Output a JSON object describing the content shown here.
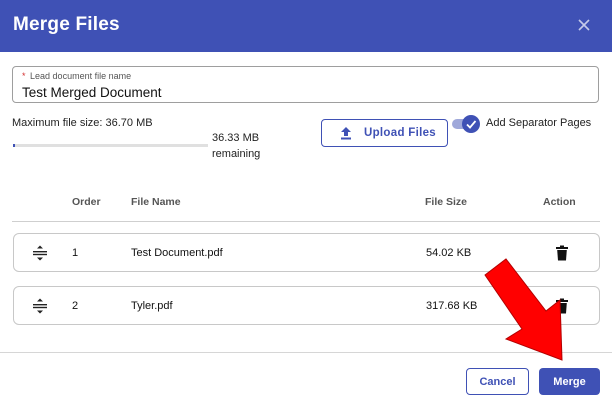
{
  "dialog": {
    "title": "Merge Files"
  },
  "lead_field": {
    "label": "Lead document file name",
    "required_marker": "*",
    "value": "Test Merged Document"
  },
  "storage": {
    "max_label": "Maximum file size: 36.70 MB",
    "remaining_label": "36.33 MB remaining",
    "used_fraction": 0.01
  },
  "upload": {
    "label": "Upload Files"
  },
  "separator": {
    "label": "Add Separator Pages",
    "checked": true
  },
  "table": {
    "headers": {
      "order": "Order",
      "name": "File Name",
      "size": "File Size",
      "action": "Action"
    },
    "rows": [
      {
        "order": "1",
        "name": "Test Document.pdf",
        "size": "54.02 KB"
      },
      {
        "order": "2",
        "name": "Tyler.pdf",
        "size": "317.68 KB"
      }
    ]
  },
  "footer": {
    "cancel_label": "Cancel",
    "merge_label": "Merge"
  },
  "colors": {
    "primary": "#3f51b5",
    "annotation_arrow": "#ff0000"
  }
}
